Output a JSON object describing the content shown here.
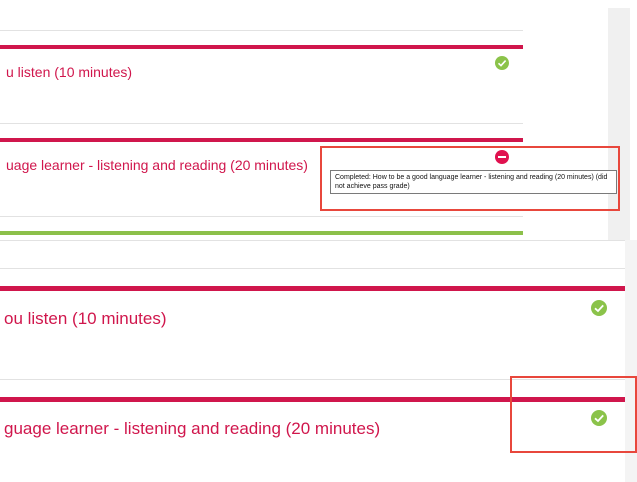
{
  "top_view": {
    "items": [
      {
        "title": "u listen (10 minutes)",
        "status": "complete-pass",
        "icon": "check-circle-icon"
      },
      {
        "title": "uage learner - listening and reading (20 minutes)",
        "status": "complete-fail",
        "icon": "minus-circle-icon"
      }
    ],
    "tooltip": "Completed: How to be a good language learner - listening and reading (20 minutes) (did not achieve pass grade)"
  },
  "bottom_view": {
    "items": [
      {
        "title": "ou listen (10 minutes)",
        "status": "complete-pass",
        "icon": "check-circle-icon"
      },
      {
        "title": "guage learner - listening and reading (20 minutes)",
        "status": "complete-pass",
        "icon": "check-circle-icon"
      }
    ]
  },
  "colors": {
    "accent_red": "#d0164c",
    "accent_green": "#8cc04a",
    "highlight_box": "#e8473c"
  }
}
